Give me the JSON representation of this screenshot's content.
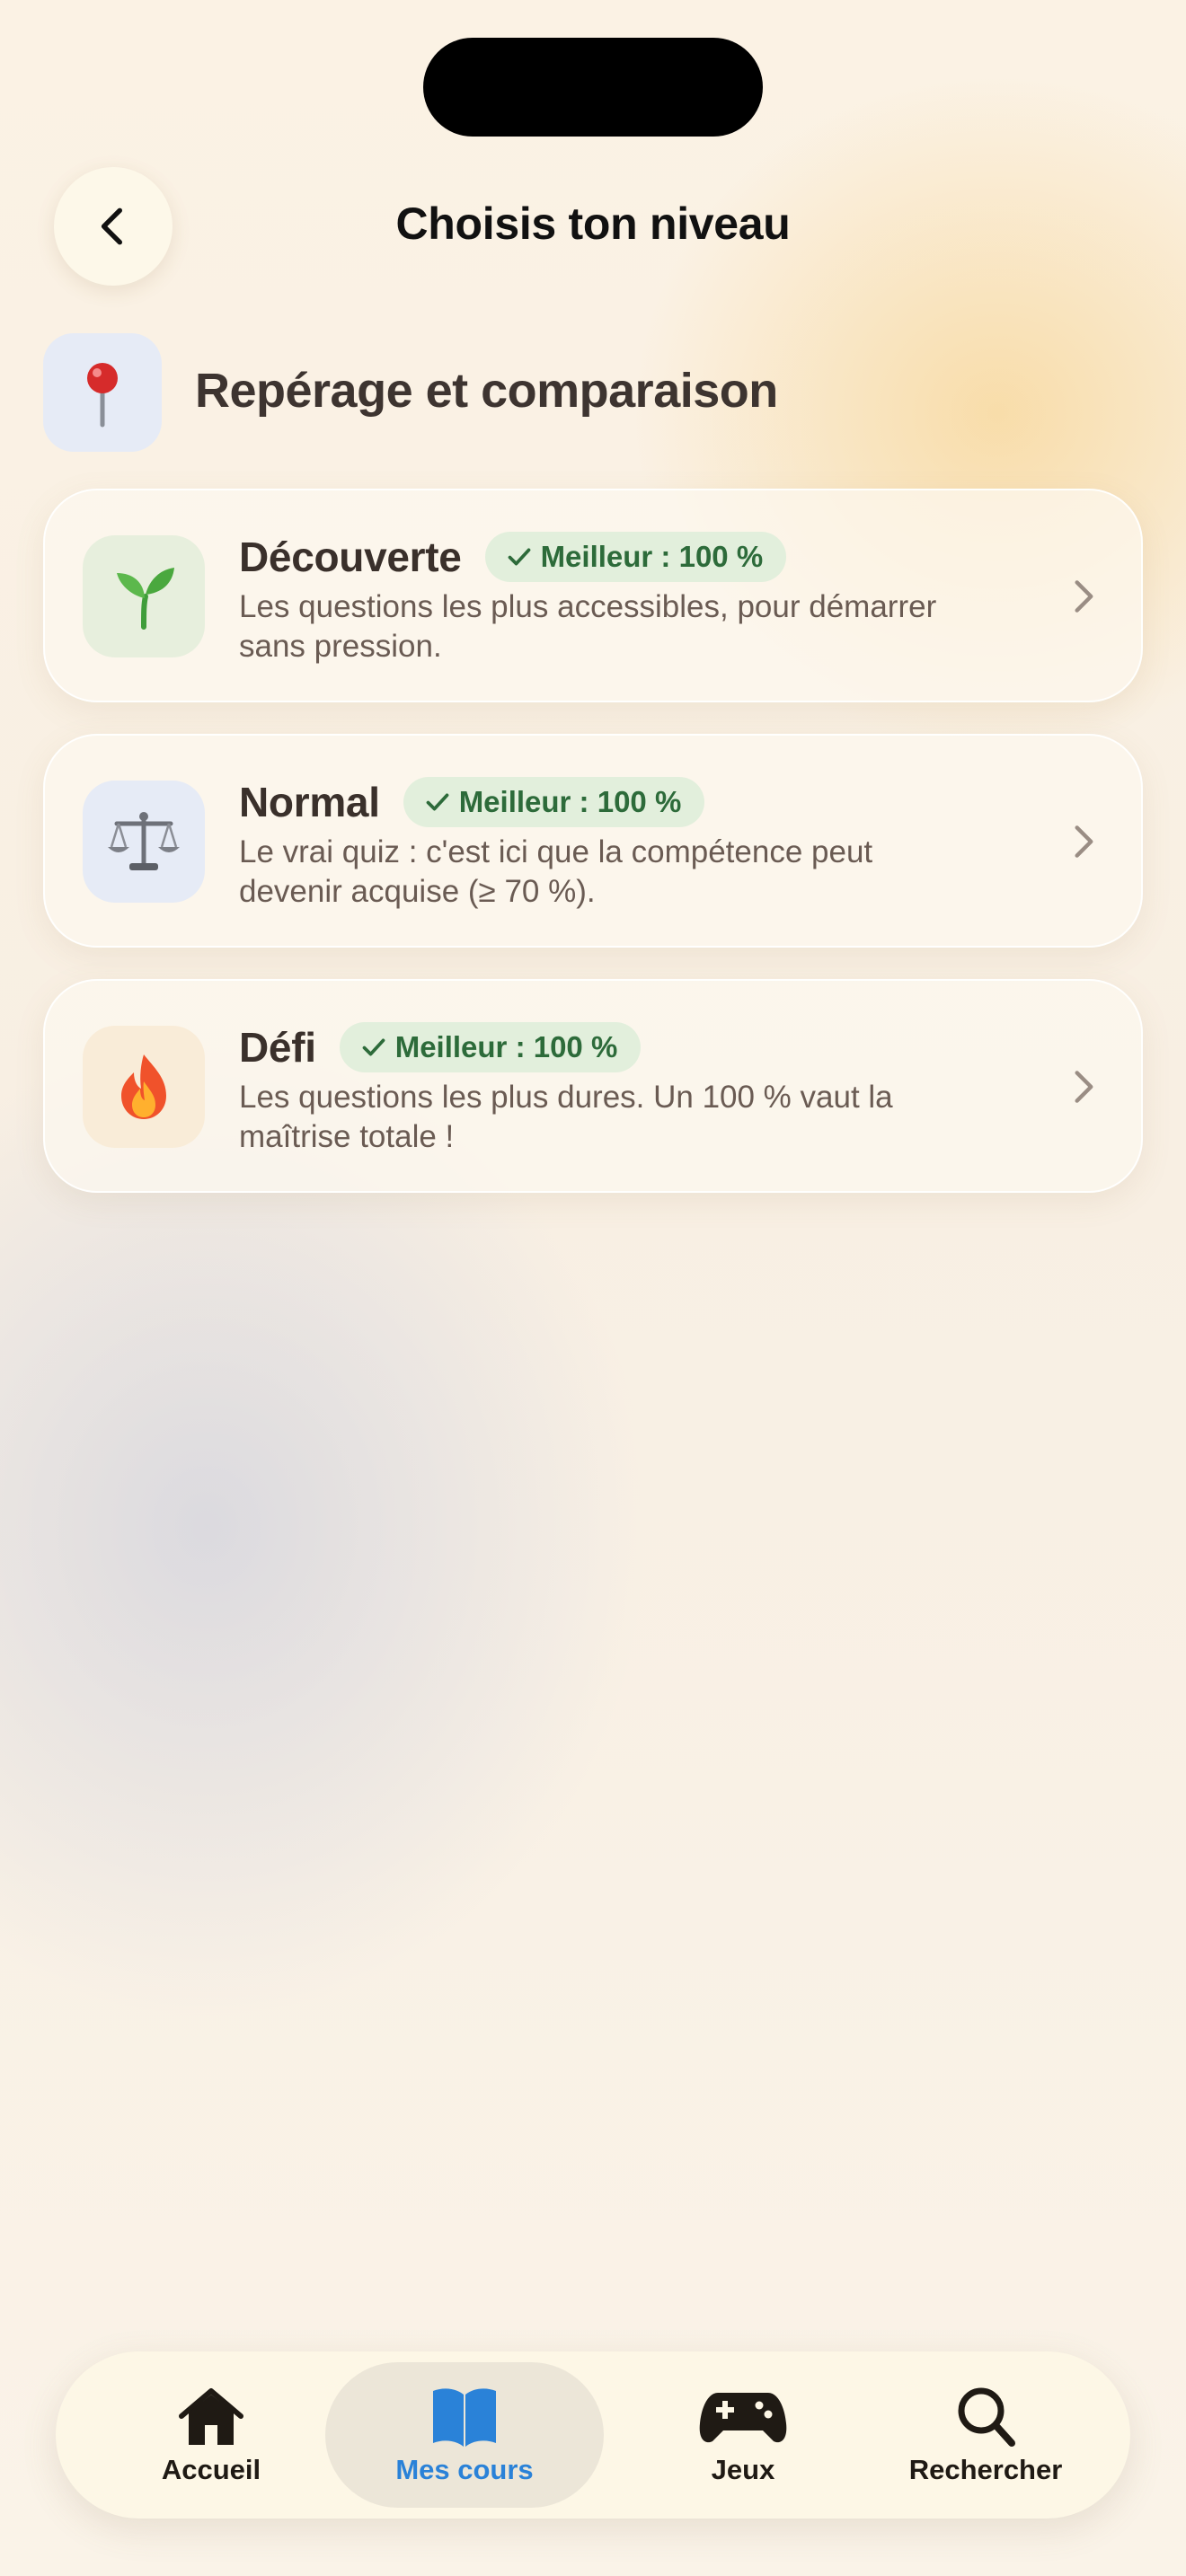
{
  "header": {
    "title": "Choisis ton niveau",
    "back_icon": "chevron-left-icon"
  },
  "section": {
    "icon": "pushpin-icon",
    "icon_bg": "#e6ebf6",
    "title": "Repérage et comparaison"
  },
  "levels": [
    {
      "name": "Découverte",
      "icon": "seedling-icon",
      "icon_bg": "#e7efdd",
      "badge": "Meilleur : 100 %",
      "description": "Les questions les plus accessibles, pour démarrer sans pression."
    },
    {
      "name": "Normal",
      "icon": "balance-scale-icon",
      "icon_bg": "#e6ebf6",
      "badge": "Meilleur : 100 %",
      "description": "Le vrai quiz : c'est ici que la compétence peut devenir acquise (≥ 70 %)."
    },
    {
      "name": "Défi",
      "icon": "fire-icon",
      "icon_bg": "#f9ecd8",
      "badge": "Meilleur : 100 %",
      "description": "Les questions les plus dures. Un 100 % vaut la maîtrise totale !"
    }
  ],
  "tabbar": {
    "items": [
      {
        "label": "Accueil",
        "icon": "house-icon",
        "active": false
      },
      {
        "label": "Mes cours",
        "icon": "book-icon",
        "active": true
      },
      {
        "label": "Jeux",
        "icon": "gamepad-icon",
        "active": false
      },
      {
        "label": "Rechercher",
        "icon": "search-icon",
        "active": false
      }
    ]
  },
  "colors": {
    "accent": "#2a82d8",
    "badge_bg": "#e2efdc",
    "badge_text": "#2d6b3a"
  }
}
